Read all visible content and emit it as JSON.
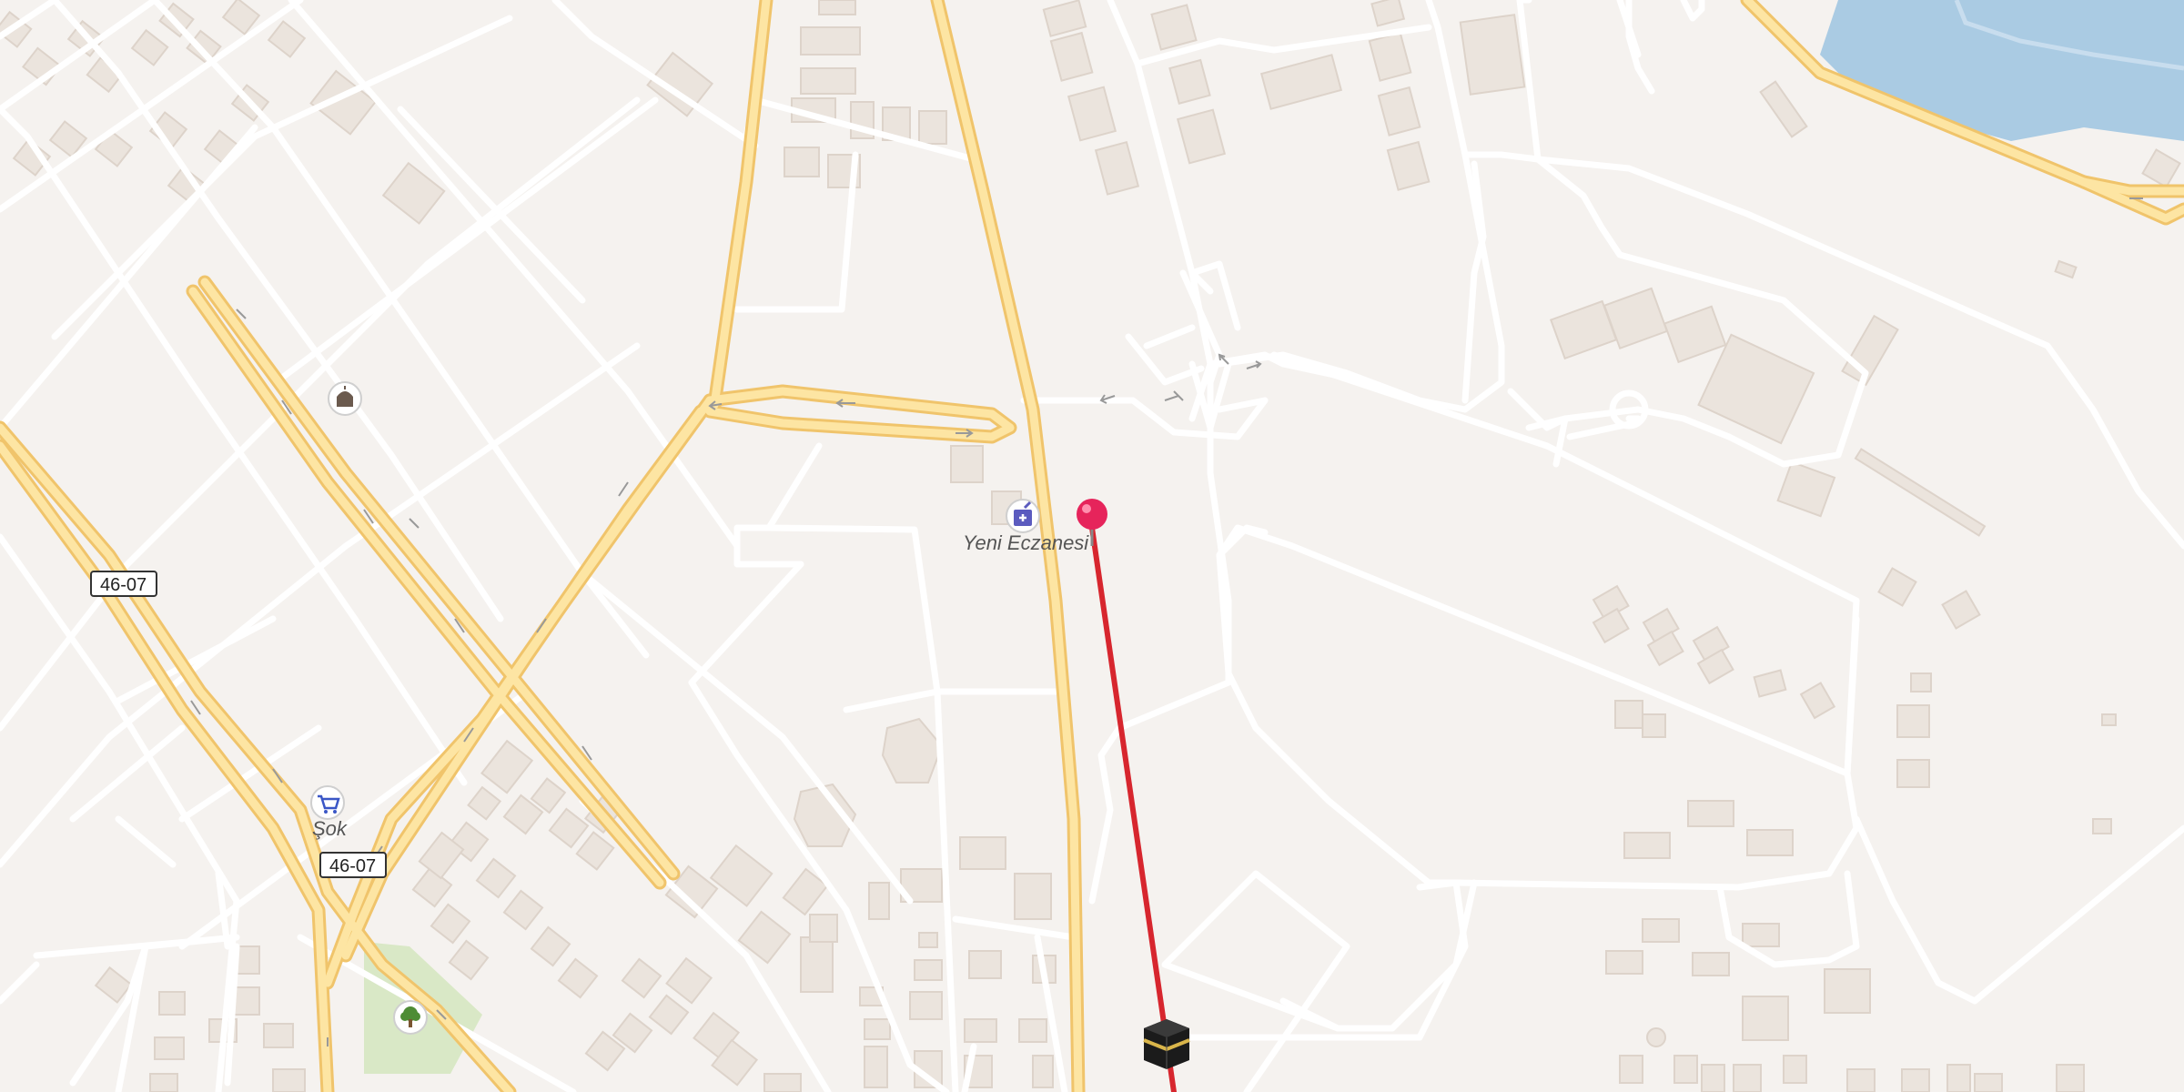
{
  "map": {
    "background": "#f5f2ef",
    "colors": {
      "road_minor": "#ffffff",
      "road_major_fill": "#fde5a3",
      "road_major_casing": "#f0c46b",
      "building": "#ebe4dd",
      "building_stroke": "#ddd3ca",
      "water": "#aacbe3",
      "park": "#d9e8c6",
      "route_line": "#d7262e",
      "pin": "#e6245b"
    },
    "pois": [
      {
        "name": "Yeni Eczanesi",
        "icon": "pharmacy-icon",
        "type": "pharmacy"
      },
      {
        "name": "Şok",
        "icon": "shopping-cart-icon",
        "type": "supermarket"
      },
      {
        "name": "",
        "icon": "mosque-icon",
        "type": "place-of-worship"
      },
      {
        "name": "",
        "icon": "tree-icon",
        "type": "park"
      }
    ],
    "road_shields": [
      "46-07",
      "46-07"
    ],
    "markers": {
      "location_pin": "map-pin-icon",
      "destination": "kaaba-icon"
    }
  }
}
